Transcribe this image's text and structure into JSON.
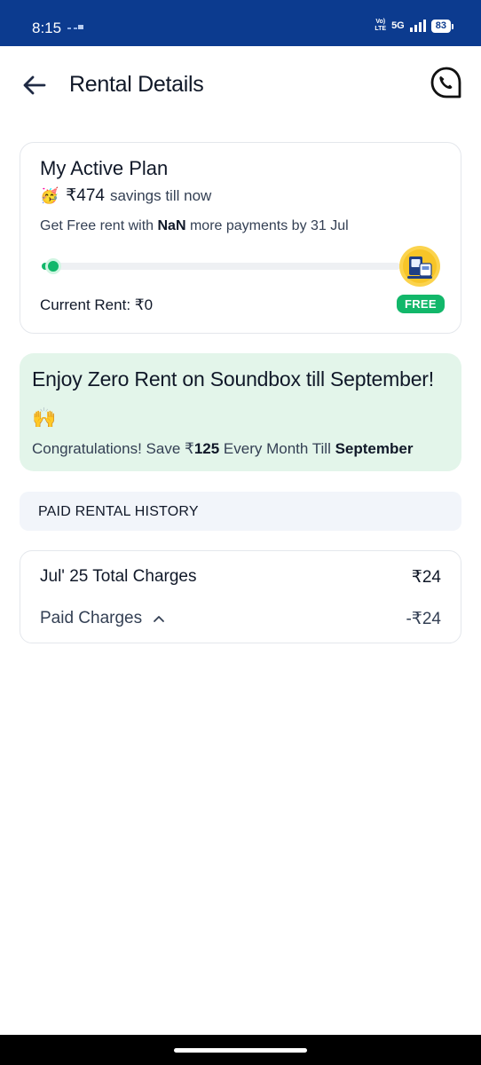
{
  "status_bar": {
    "time": "8:15",
    "network_top": "Vo)",
    "network_bottom": "LTE",
    "network_type": "5G",
    "battery": "83"
  },
  "header": {
    "title": "Rental Details",
    "back_icon": "arrow-left-icon",
    "help_icon": "phone-chat-icon"
  },
  "plan": {
    "title": "My Active Plan",
    "party_emoji": "🥳",
    "savings_amount": "₹474",
    "savings_suffix": "savings till now",
    "free_prefix": "Get Free rent with",
    "free_count": "NaN",
    "free_suffix": "more payments by 31 Jul",
    "progress_fraction": 0.02,
    "current_rent": "Current Rent: ₹0",
    "free_badge": "FREE",
    "goal_icon": "soundbox-device-icon"
  },
  "promo": {
    "title": "Enjoy Zero Rent on Soundbox till September!",
    "emoji": "🙌",
    "text_prefix": "Congratulations! Save ₹",
    "amount": "125",
    "text_middle": "Every Month Till",
    "month": "September"
  },
  "history": {
    "header": "PAID RENTAL HISTORY",
    "month_title": "Jul' 25 Total Charges",
    "total_amount": "₹24",
    "paid_label": "Paid Charges",
    "paid_amount": "-₹24"
  },
  "colors": {
    "status_bar": "#0c3b8f",
    "accent_green": "#12b76a",
    "promo_bg": "#e3f5ea",
    "history_header_bg": "#f2f5fa"
  }
}
